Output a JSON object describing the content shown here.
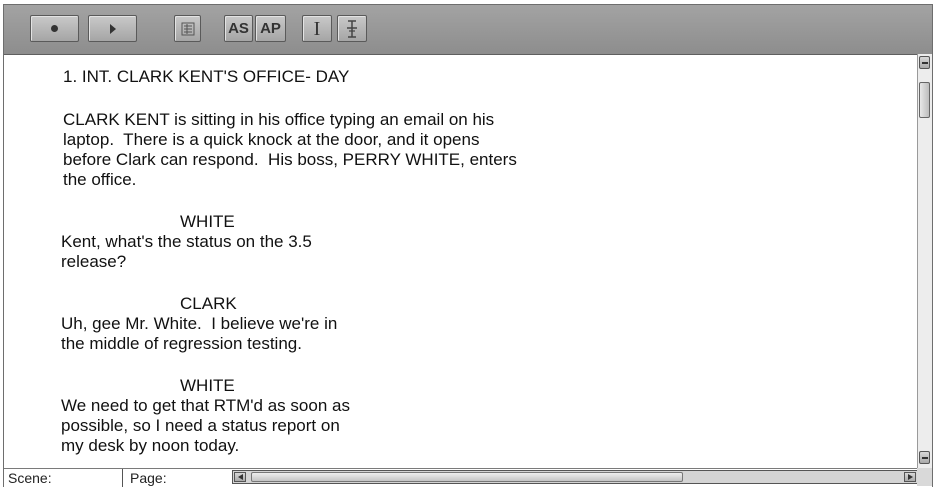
{
  "toolbar": {
    "buttons": [
      {
        "name": "record-button",
        "icon": "record-dot-icon"
      },
      {
        "name": "play-button",
        "icon": "play-triangle-icon"
      },
      {
        "name": "script-button",
        "icon": "script-page-icon"
      },
      {
        "name": "as-button",
        "label": "AS"
      },
      {
        "name": "ap-button",
        "label": "AP"
      },
      {
        "name": "text-cursor-button",
        "icon": "i-beam-icon"
      },
      {
        "name": "text-split-button",
        "icon": "i-beam-split-icon"
      }
    ]
  },
  "script": {
    "scene_heading": "1. INT. CLARK KENT'S OFFICE- DAY",
    "action_lines": [
      "CLARK KENT is sitting in his office typing an email on his",
      "laptop.  There is a quick knock at the door, and it opens",
      "before Clark can respond.  His boss, PERRY WHITE, enters",
      "the office."
    ],
    "dialogues": [
      {
        "character": "WHITE",
        "lines": [
          "Kent, what's the status on the 3.5",
          "release?"
        ]
      },
      {
        "character": "CLARK",
        "lines": [
          "Uh, gee Mr. White.  I believe we're in",
          "the middle of regression testing."
        ]
      },
      {
        "character": "WHITE",
        "lines": [
          "We need to get that RTM'd as soon as",
          "possible, so I need a status report on",
          "my desk by noon today."
        ]
      }
    ]
  },
  "status_bar": {
    "scene_label": "Scene:",
    "page_label": "Page:"
  }
}
